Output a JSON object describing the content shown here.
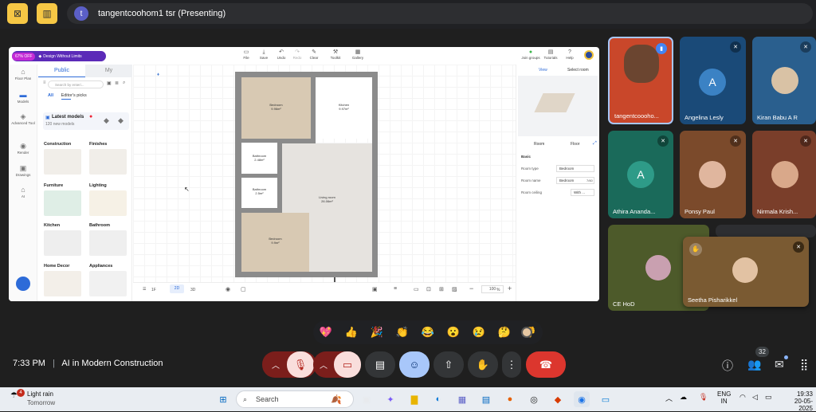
{
  "topbar": {
    "presenter_initial": "t",
    "presentation_title": "tangentcoohom1 tsr (Presenting)"
  },
  "shared_screen": {
    "promo": {
      "discount": "67% OFF",
      "label": "Design Without Limits"
    },
    "toolbar": [
      "File",
      "Save",
      "Undo",
      "Redo",
      "Clear",
      "Toolkit",
      "Gallery"
    ],
    "top_right": [
      "Join groups",
      "Tutorials",
      "Help"
    ],
    "left_rail": [
      "Floor Plan",
      "Models",
      "Advanced Tool",
      "Render",
      "Drawings",
      "AI"
    ],
    "library": {
      "tab_public": "Public",
      "tab_my": "My",
      "search_placeholder": "Search by enteri...",
      "sub_all": "All",
      "sub_editors": "Editor's picks",
      "latest_title": "Latest models",
      "latest_sub": "120 new models",
      "categories": [
        "Construction",
        "Finishes",
        "Furniture",
        "Lighting",
        "Kitchen",
        "Bathroom",
        "Home Decor",
        "Appliances"
      ]
    },
    "rooms": {
      "bedroom1": "Bedroom",
      "bedroom1_area": "9.96m²",
      "kitchen": "Kitchen",
      "kitchen_area": "9.97m²",
      "bath1": "Bathroom",
      "bath1_area": "2.48m²",
      "bath2": "Bathroom",
      "bath2_area": "2.5m²",
      "living": "Living room",
      "living_area": "26.06m²",
      "bedroom2": "Bedroom",
      "bedroom2_area": "9.9m²"
    },
    "bottombar": {
      "floor": "1F",
      "mode2d": "2D",
      "mode3d": "3D",
      "zoom": "100",
      "zoom_unit": "%"
    },
    "rightpanel": {
      "view": "View",
      "select_room": "Select room",
      "tab_room": "Room",
      "tab_floor": "Floor",
      "basic": "Basic",
      "room_type_label": "Room type",
      "room_type_value": "Bedroom",
      "room_name_label": "Room name",
      "room_name_value": "Bedroom",
      "room_name_count": "7/60",
      "ceiling_label": "Room ceiling",
      "ceiling_value": "With ..."
    }
  },
  "participants": [
    {
      "name": "tangentcoooho...",
      "type": "video"
    },
    {
      "name": "Angelina Lesly",
      "initial": "A"
    },
    {
      "name": "Kiran Babu A R"
    },
    {
      "name": "Athira Ananda...",
      "initial": "A"
    },
    {
      "name": "Ponsy Paul"
    },
    {
      "name": "Nirmala Krish..."
    },
    {
      "name": "CE HoD"
    },
    {
      "name": "Seetha Pisharikkel"
    }
  ],
  "reactions": [
    "💖",
    "👍",
    "🎉",
    "👏",
    "😂",
    "😮",
    "😢",
    "🤔",
    "👎"
  ],
  "meeting": {
    "time": "7:33 PM",
    "separator": "|",
    "title": "AI in Modern Construction",
    "people_count": "32"
  },
  "taskbar": {
    "weather_badge": "4",
    "weather_title": "Light rain",
    "weather_sub": "Tomorrow",
    "search": "Search",
    "lang1": "ENG",
    "lang2": "IN",
    "clock_time": "19:33",
    "clock_date": "20-05-2025"
  }
}
